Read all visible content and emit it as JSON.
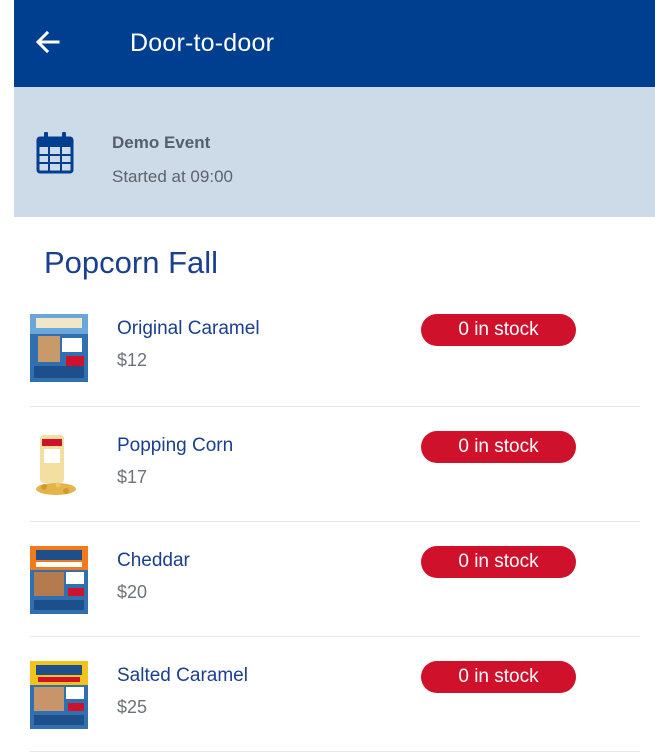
{
  "app_bar": {
    "back_icon": "arrow-left-icon",
    "title": "Door-to-door",
    "background": "#003f8f"
  },
  "event": {
    "icon": "calendar-icon",
    "name": "Demo Event",
    "started": "Started at 09:00",
    "background": "#cddbe8"
  },
  "section": {
    "title": "Popcorn Fall"
  },
  "products": [
    {
      "name": "Original Caramel",
      "price": "$12",
      "stock": "0 in stock"
    },
    {
      "name": "Popping Corn",
      "price": "$17",
      "stock": "0 in stock"
    },
    {
      "name": "Cheddar",
      "price": "$20",
      "stock": "0 in stock"
    },
    {
      "name": "Salted Caramel",
      "price": "$25",
      "stock": "0 in stock"
    }
  ],
  "colors": {
    "accent": "#1a3f8e",
    "stock_badge": "#d0112b"
  }
}
